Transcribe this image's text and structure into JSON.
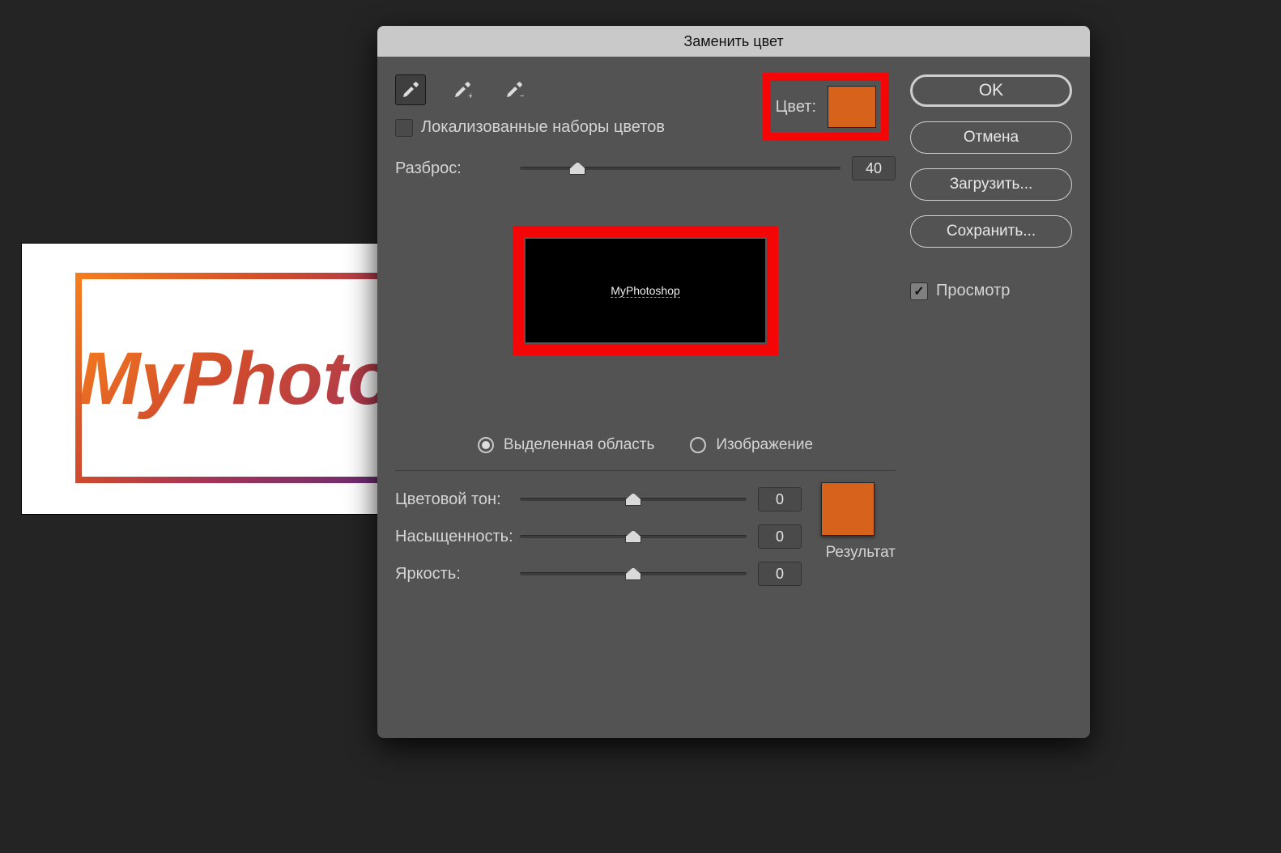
{
  "canvas": {
    "text": "MyPhoto"
  },
  "dialog": {
    "title": "Заменить цвет",
    "localized_sets_label": "Локализованные наборы цветов",
    "localized_sets_checked": false,
    "color_label": "Цвет:",
    "source_color": "#d7621b",
    "fuzziness": {
      "label": "Разброс:",
      "value": "40",
      "thumb_pct": 18
    },
    "preview_trace": "MyPhotoshop",
    "view_mode": {
      "selection_label": "Выделенная область",
      "image_label": "Изображение",
      "selected": "selection"
    },
    "hue": {
      "label": "Цветовой тон:",
      "value": "0",
      "thumb_pct": 50
    },
    "saturation": {
      "label": "Насыщенность:",
      "value": "0",
      "thumb_pct": 50
    },
    "lightness": {
      "label": "Яркость:",
      "value": "0",
      "thumb_pct": 50
    },
    "result_label": "Результат",
    "result_color": "#d7621b"
  },
  "buttons": {
    "ok": "OK",
    "cancel": "Отмена",
    "load": "Загрузить...",
    "save": "Сохранить..."
  },
  "preview_checkbox": {
    "label": "Просмотр",
    "checked": true
  }
}
